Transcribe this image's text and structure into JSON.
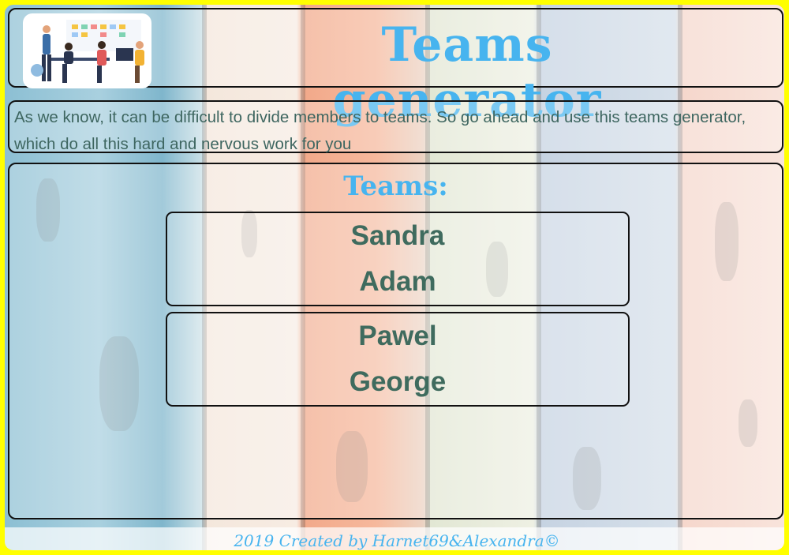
{
  "header": {
    "title": "Teams generator",
    "logo_icon": "team-workshop-illustration"
  },
  "intro": {
    "text": "As we know, it can be difficult to divide members to teams. So go ahead and use this teams generator, which do all this hard and nervous work for you"
  },
  "teams_section": {
    "title": "Teams:",
    "teams": [
      {
        "members": [
          "Sandra",
          "Adam"
        ]
      },
      {
        "members": [
          "Pawel",
          "George"
        ]
      }
    ]
  },
  "footer": {
    "text": "2019 Created by Harnet69&Alexandra©"
  },
  "colors": {
    "accent": "#47b4ef",
    "member_text": "#3f6b5e",
    "border": "#ffff00"
  }
}
